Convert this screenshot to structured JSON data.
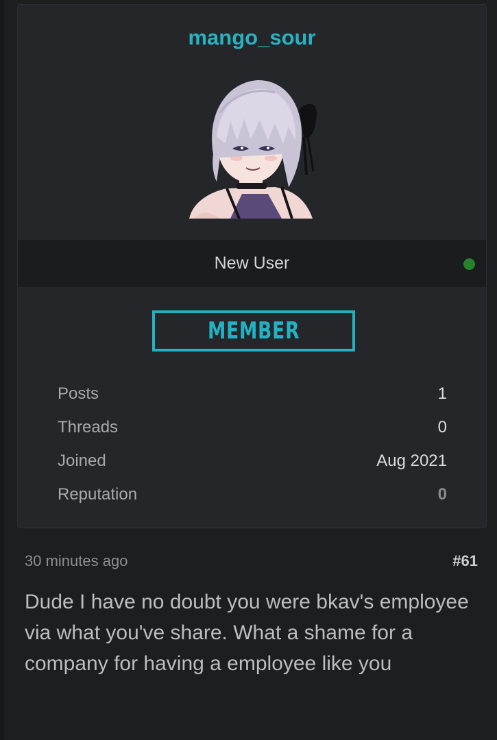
{
  "profile": {
    "username": "mango_sour",
    "user_title": "New User",
    "online_color": "#27822c",
    "badge_text": "MEMBER",
    "badge_color": "#23b2c4",
    "stats": [
      {
        "label": "Posts",
        "value": "1"
      },
      {
        "label": "Threads",
        "value": "0"
      },
      {
        "label": "Joined",
        "value": "Aug 2021"
      },
      {
        "label": "Reputation",
        "value": "0"
      }
    ]
  },
  "post": {
    "time": "30 minutes ago",
    "number": "#61",
    "body": "Dude I have no doubt you were bkav's employee via what you've share. What a shame for a company for having a employee like you"
  },
  "colors": {
    "accent": "#29b2c3",
    "background": "#1d1e20",
    "card": "#25262a"
  }
}
